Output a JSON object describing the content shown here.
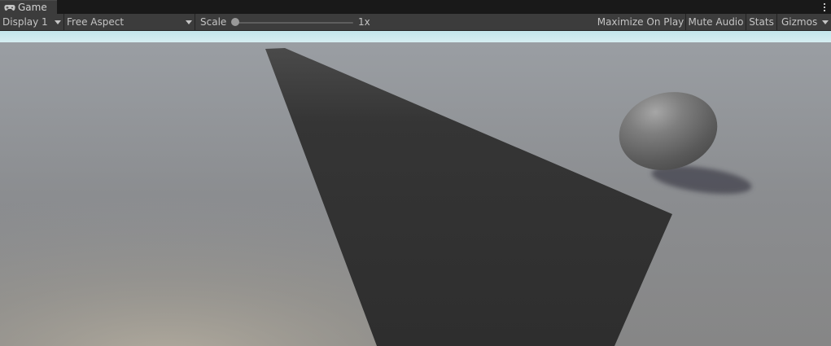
{
  "tab": {
    "label": "Game",
    "icon": "gamepad-icon"
  },
  "toolbar": {
    "display": "Display 1",
    "aspect": "Free Aspect",
    "scale_label": "Scale",
    "scale_value": "1x",
    "scale_level": 0,
    "maximize": "Maximize On Play",
    "mute": "Mute Audio",
    "stats": "Stats",
    "gizmos": "Gizmos"
  },
  "colors": {
    "panel": "#3c3c3c",
    "tabbar": "#191919",
    "sky": "#c2e5ea",
    "ground": "#8a8a8a",
    "plane": "#2f2f2f",
    "sphere": "#6e6e6e"
  },
  "scene": {
    "objects": [
      "ground",
      "plane",
      "sphere",
      "sphere-shadow"
    ]
  }
}
